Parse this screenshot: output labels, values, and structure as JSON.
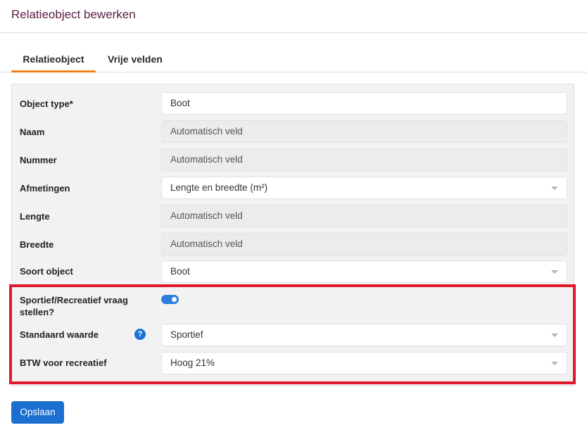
{
  "header": {
    "title": "Relatieobject bewerken"
  },
  "tabs": [
    {
      "label": "Relatieobject",
      "active": true
    },
    {
      "label": "Vrije velden",
      "active": false
    }
  ],
  "form": {
    "object_type": {
      "label": "Object type*",
      "value": "Boot"
    },
    "naam": {
      "label": "Naam",
      "value": "Automatisch veld"
    },
    "nummer": {
      "label": "Nummer",
      "value": "Automatisch veld"
    },
    "afmetingen": {
      "label": "Afmetingen",
      "value": "Lengte en breedte (m²)"
    },
    "lengte": {
      "label": "Lengte",
      "value": "Automatisch veld"
    },
    "breedte": {
      "label": "Breedte",
      "value": "Automatisch veld"
    },
    "soort_object": {
      "label": "Soort object",
      "value": "Boot"
    },
    "sportief_vraag": {
      "label_line1": "Sportief/Recreatief vraag",
      "label_line2": "stellen?",
      "enabled": true
    },
    "standaard_waarde": {
      "label": "Standaard waarde",
      "value": "Sportief",
      "help_icon": "?"
    },
    "btw_recreatief": {
      "label": "BTW voor recreatief",
      "value": "Hoog 21%"
    }
  },
  "actions": {
    "save_label": "Opslaan"
  },
  "colors": {
    "title": "#5a1d43",
    "tab_underline": "#ee7f1b",
    "primary": "#1a6fd1",
    "highlight_border": "#e1182b"
  }
}
